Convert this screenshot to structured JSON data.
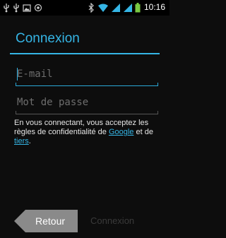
{
  "status_bar": {
    "time": "10:16",
    "icons": [
      "usb-icon",
      "usb-icon",
      "image-icon",
      "camera-icon",
      "bluetooth-icon",
      "wifi-icon",
      "signal-icon",
      "signal-icon",
      "battery-icon"
    ]
  },
  "page": {
    "title": "Connexion"
  },
  "form": {
    "email_placeholder": "E-mail",
    "email_value": "",
    "password_placeholder": "Mot de passe",
    "password_value": ""
  },
  "terms": {
    "prefix": "En vous connectant, vous acceptez les règles de confidentialité de ",
    "google_link": "Google",
    "middle": " et de ",
    "tiers_link": "tiers",
    "suffix": "."
  },
  "buttons": {
    "back_label": "Retour",
    "next_label": "Connexion"
  },
  "colors": {
    "accent": "#35b5e5",
    "background": "#0d0d0d",
    "disabled_text": "#3a3a3a"
  }
}
